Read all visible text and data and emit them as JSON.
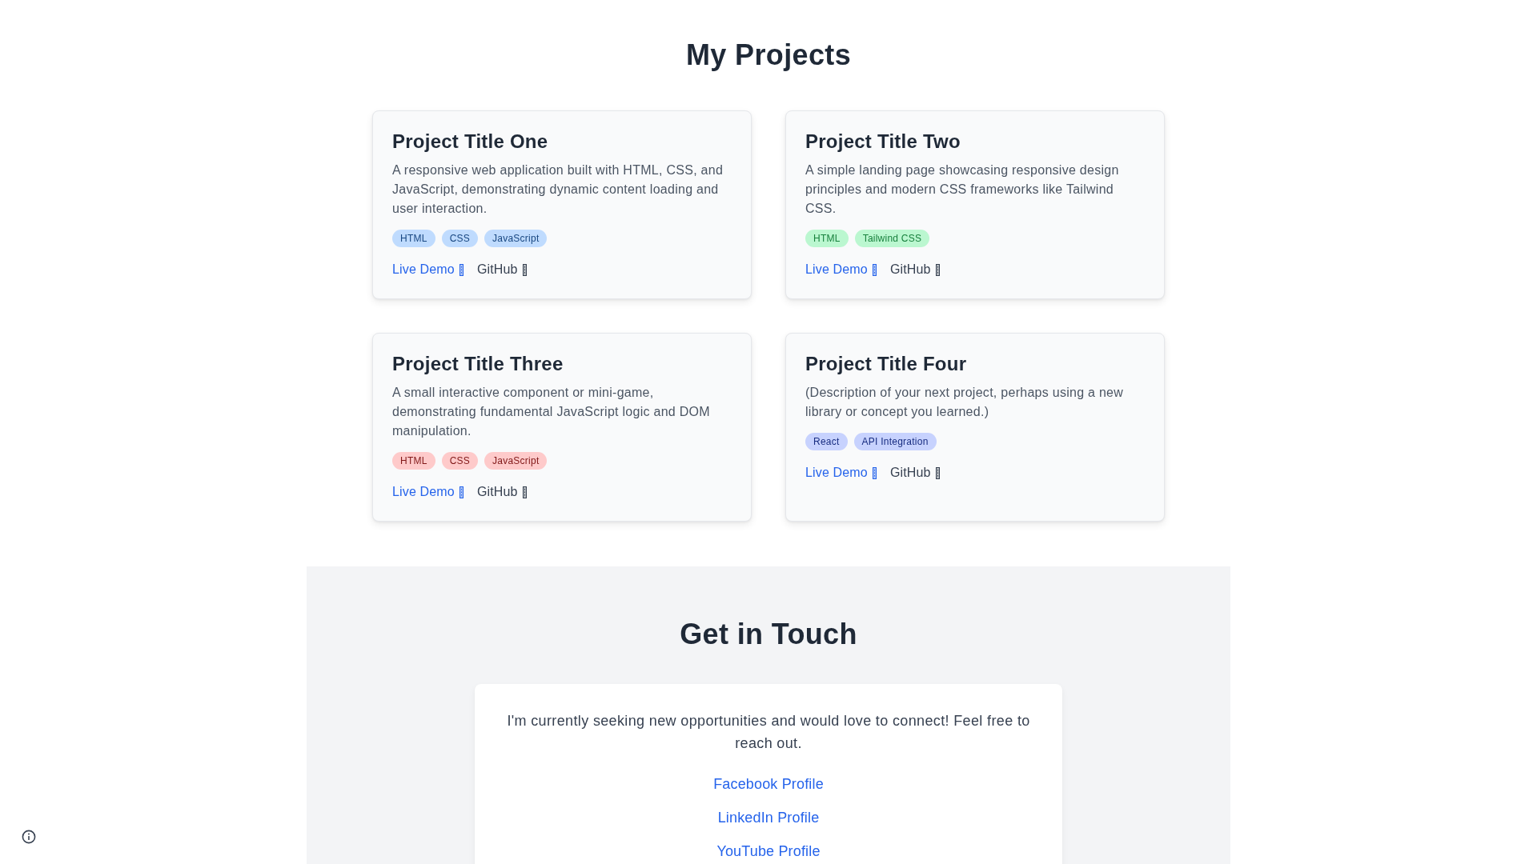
{
  "projects_section": {
    "heading": "My Projects",
    "projects": [
      {
        "title": "Project Title One",
        "description": "A responsive web application built with HTML, CSS, and JavaScript, demonstrating dynamic content loading and user interaction.",
        "tags": [
          {
            "label": "HTML",
            "color": "#bfdbfe"
          },
          {
            "label": "CSS",
            "color": "#bfdbfe"
          },
          {
            "label": "JavaScript",
            "color": "#bfdbfe"
          }
        ],
        "links": [
          {
            "label": "Live Demo",
            "kind": "primary"
          },
          {
            "label": "GitHub",
            "kind": "secondary"
          }
        ]
      },
      {
        "title": "Project Title Two",
        "description": "A simple landing page showcasing responsive design principles and modern CSS frameworks like Tailwind CSS.",
        "tags": [
          {
            "label": "HTML",
            "color": "#bbf7d0"
          },
          {
            "label": "Tailwind CSS",
            "color": "#bbf7d0"
          }
        ],
        "links": [
          {
            "label": "Live Demo",
            "kind": "primary"
          },
          {
            "label": "GitHub",
            "kind": "secondary"
          }
        ]
      },
      {
        "title": "Project Title Three",
        "description": "A small interactive component or mini-game, demonstrating fundamental JavaScript logic and DOM manipulation.",
        "tags": [
          {
            "label": "HTML",
            "color": "#fecaca"
          },
          {
            "label": "CSS",
            "color": "#fecaca"
          },
          {
            "label": "JavaScript",
            "color": "#fecaca"
          }
        ],
        "links": [
          {
            "label": "Live Demo",
            "kind": "primary"
          },
          {
            "label": "GitHub",
            "kind": "secondary"
          }
        ]
      },
      {
        "title": "Project Title Four",
        "description": "(Description of your next project, perhaps using a new library or concept you learned.)",
        "tags": [
          {
            "label": "React",
            "color": "#c7d2fe"
          },
          {
            "label": "API Integration",
            "color": "#c7d2fe"
          }
        ],
        "links": [
          {
            "label": "Live Demo",
            "kind": "primary"
          },
          {
            "label": "GitHub",
            "kind": "secondary"
          }
        ]
      }
    ]
  },
  "contact_section": {
    "heading": "Get in Touch",
    "message": "I'm currently seeking new opportunities and would love to connect! Feel free to reach out.",
    "links": [
      "Facebook Profile",
      "LinkedIn Profile",
      "YouTube Profile"
    ]
  }
}
